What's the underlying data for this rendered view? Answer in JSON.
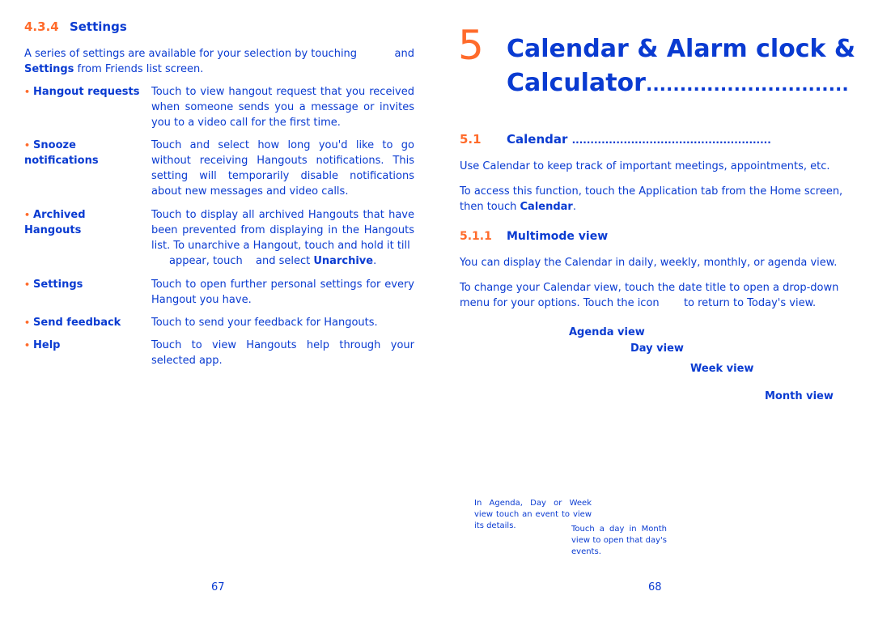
{
  "left_page": {
    "section": {
      "number": "4.3.4",
      "title": "Settings"
    },
    "intro": {
      "part1": "A series of settings are available for your selection by touching",
      "part2": "and",
      "bold": "Settings",
      "part3": " from Friends list screen."
    },
    "items": [
      {
        "label": "Hangout requests",
        "desc": "Touch to view hangout request that you received when someone sends you a message or invites you to a video call for the first time."
      },
      {
        "label": "Snooze notifications",
        "desc": "Touch and select how long you'd like to go without receiving Hangouts notifications. This setting will temporarily disable notifications about new messages and video calls."
      },
      {
        "label": "Archived Hangouts",
        "desc": "Touch to display all archived Hangouts that have been prevented from displaying in the Hangouts list. To unarchive a Hangout, touch and hold it till",
        "desc_tail": "appear, touch",
        "desc_tail2": "and select",
        "desc_bold": "Unarchive",
        "desc_end": "."
      },
      {
        "label": "Settings",
        "desc": "Touch to open further personal settings for every Hangout you have."
      },
      {
        "label": "Send feedback",
        "desc": "Touch to send your feedback for Hangouts."
      },
      {
        "label": "Help",
        "desc": "Touch to view Hangouts help through your selected app."
      }
    ],
    "page_number": "67"
  },
  "right_page": {
    "chapter": {
      "number": "5",
      "title_line1": "Calendar & Alarm clock &",
      "title_line2": "Calculator",
      "leader": ".............................."
    },
    "section": {
      "number": "5.1",
      "title": "Calendar",
      "leader": "......................................................"
    },
    "para1": "Use Calendar to keep track of important meetings, appointments, etc.",
    "para2": {
      "text": "To access this function, touch the Application tab from the Home screen, then touch ",
      "bold": "Calendar",
      "end": "."
    },
    "subsection": {
      "number": "5.1.1",
      "title": "Multimode view"
    },
    "para3": "You can display the Calendar in daily, weekly, monthly, or agenda view.",
    "para4": {
      "part1": "To change your Calendar view, touch the date title to open a drop-down menu for your options. Touch the icon",
      "part2": "to return to Today's view."
    },
    "views": [
      "Agenda view",
      "Day view",
      "Week view",
      "Month view"
    ],
    "caption1": "In Agenda, Day or Week view touch an event to view its details.",
    "caption2": "Touch a day in Month view to open that day's events.",
    "page_number": "68"
  }
}
